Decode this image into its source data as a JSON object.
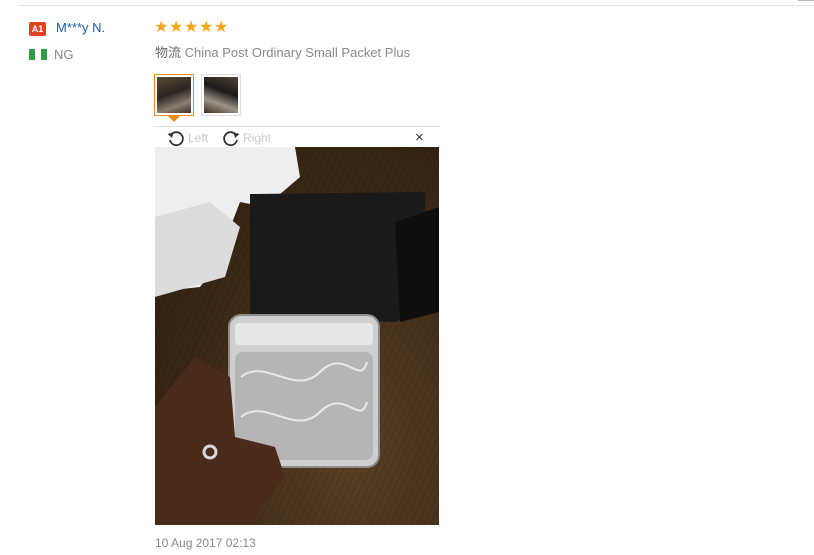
{
  "review": {
    "buyer_badge": "A1",
    "buyer_name": "M***y N.",
    "country_code": "NG",
    "flag_colors": [
      "#2e9d44",
      "#ffffff",
      "#2e9d44"
    ],
    "rating_stars": 5,
    "shipping_prefix": "物流",
    "shipping_method": "China Post Ordinary Small Packet Plus",
    "thumbnails": [
      "photo-1",
      "photo-2"
    ],
    "active_thumbnail": 1,
    "viewer": {
      "rotate_left_label": "Left",
      "rotate_right_label": "Right",
      "close_symbol": "×"
    },
    "date": "10 Aug 2017 02:13"
  },
  "colors": {
    "badge": "#e0411f",
    "name": "#1a5ca8",
    "star": "#f7a51c",
    "active_border": "#f28a18"
  },
  "icons": [
    "rotate-left-icon",
    "rotate-right-icon",
    "close-icon",
    "star-icon",
    "flag-icon"
  ]
}
